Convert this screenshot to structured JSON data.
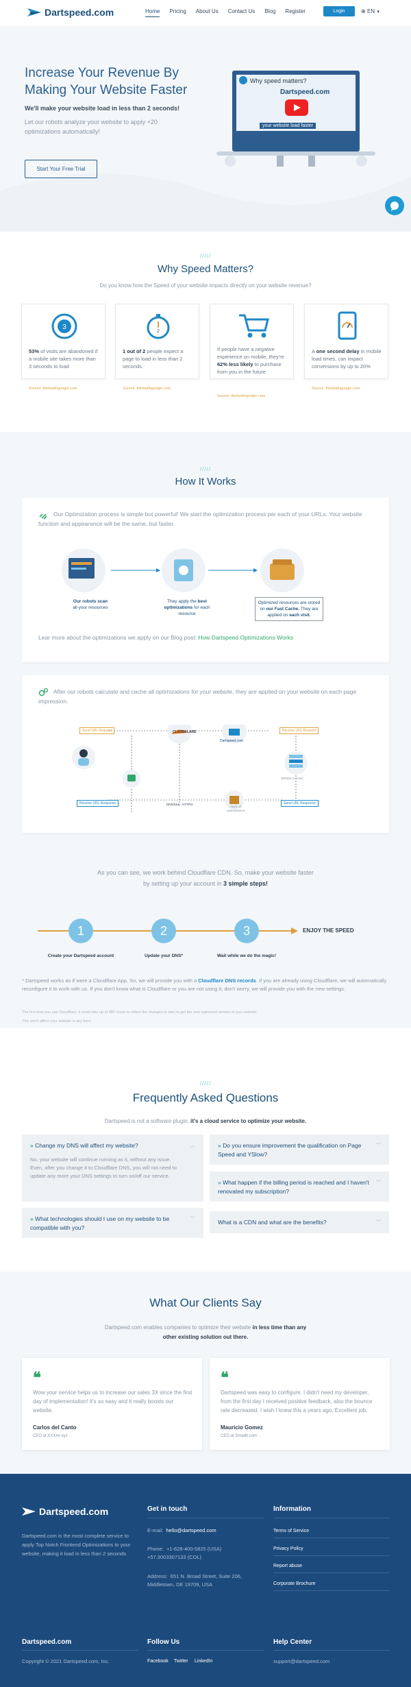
{
  "nav": {
    "logo": "Dartspeed.com",
    "items": [
      "Home",
      "Pricing",
      "About Us",
      "Contact Us",
      "Blog",
      "Register"
    ],
    "login": "Login",
    "lang": "EN"
  },
  "hero": {
    "title": "Increase Your Revenue By Making Your Website Faster",
    "subtitle": "We'll make your website load in less than 2 seconds!",
    "desc": "Let our robots analyze your website to apply +20 optimizations automatically!",
    "cta": "Start Your Free Trial",
    "video_title": "Why speed matters?",
    "video_brand": "Dartspeed.com",
    "video_caption": "your website load faster"
  },
  "why": {
    "dashes": "/////",
    "title": "Why Speed Matters?",
    "subtitle": "Do you know how the Speed of your website impacts directly on your website revenue?",
    "cards": [
      {
        "pre": "",
        "bold": "53%",
        "post": " of visits are abandoned if a mobile site takes more than 3 seconds to load",
        "source": "Source: thinkwithgoogle.com"
      },
      {
        "pre": "",
        "bold": "1 out of 2",
        "post": " people expect a page to load in less than 2 seconds.",
        "source": "Source: thinkwithgoogle.com"
      },
      {
        "pre": "If people have a negative experience on mobile, they're ",
        "bold": "62% less likely",
        "post": " to purchase from you in the future",
        "source": "Source: thinkwithgoogle.com"
      },
      {
        "pre": "A ",
        "bold": "one second delay",
        "post": " in mobile load times, can impact conversions by up to 20%",
        "source": "Source: thinkwithgoogle.com"
      }
    ]
  },
  "how": {
    "dashes": "/////",
    "title": "How It Works",
    "p1": "Our Optimization process is simple but powerful! We start the optimization process per each of your URLs. Your website function and appearance will be the same, but faster.",
    "step_a_bold": "Our robots scan",
    "step_a": "all your resources",
    "step_b": "They apply the",
    "step_b_bold": "best optimizations",
    "step_b2": "for each resource",
    "step_c": "Optimized resources are stored on",
    "step_c_bold": "our Fast Cache.",
    "step_c2": "They are applied on",
    "step_c_bold2": "each visit.",
    "blog_text": "Lear more about the optimizations we apply on our Blog post:",
    "blog_link": "How Dartspeed Optimizations Works",
    "p2": "After our robots calculate and cache all optimizations for your website, they are applied on your website on each page impression.",
    "diagram": {
      "send": "Send URL Request",
      "cloudflare": "CLOUDFLARE",
      "dartspeed": "Dartspeed.com",
      "receive_r": "Receive URL Request",
      "send_resp": "Send URL Response",
      "receive_resp": "Receive URL Response",
      "dns": "DNS/SSL - HTTP/2",
      "apply": "Apply all optimizations",
      "cache": "SPEED CACHE"
    },
    "cf1": "As you can see, we work behind Cloudflare CDN. So, make your website faster",
    "cf2_pre": "by setting up your account in ",
    "cf2_bold": "3 simple steps!",
    "steps": [
      {
        "n": "1",
        "label": "Create your Dartspeed account"
      },
      {
        "n": "2",
        "label": "Update your DNS*"
      },
      {
        "n": "3",
        "label": "Wait while we do the magic!"
      }
    ],
    "enjoy": "ENJOY THE SPEED",
    "note1_pre": "* Dartspeed works as if were a Cloudflare App. So, we will provide you with a ",
    "note1_bold": "Cloudflare DNS records",
    "note1_post": ". If you are already using Cloudflare, we will automatically reconfigure it to work with us. If you don't know what is Cloudflare or you are not using it, don't worry, we will provide you with the new settings.",
    "note2": "The first time you use Cloudflare, it could take up to 48h hours to reflect the changes to start to get the new optimized version of your website.",
    "note3": "This won't affect your website in any form."
  },
  "faq": {
    "dashes": "/////",
    "title": "Frequently Asked Questions",
    "sub_pre": "Dartspeed is not a software plugin, ",
    "sub_bold": "it's a cloud service to optimize your website.",
    "items": [
      {
        "q": "Change my DNS will affect my website?",
        "a": "No, your website will continue running as it, without any issue. Even, after you change it to Cloudflare DNS, you will not need to update any more your DNS settings to turn on/off our service."
      },
      {
        "q": "What technologies should I use on my website to be compatible with you?"
      },
      {
        "q": "Do you ensure improvement the qualification on Page Speed and YSlow?"
      },
      {
        "q": "What happen if the billing period is reached and I haven't renovated my subscription?"
      },
      {
        "q": "What is a CDN and what are the benefits?"
      }
    ]
  },
  "clients": {
    "title": "What Our Clients Say",
    "sub_pre": "Dartspeed.com enables companies to optimize their website ",
    "sub_bold": "in less time than any other existing solution out there.",
    "items": [
      {
        "quote": "Wow your service helps us to increase our sales 3X since the first day of implementation! It's so easy and it really boosts our website.",
        "name": "Carlos del Canto",
        "role": "CEO at XXX##.xyz"
      },
      {
        "quote": "Dartspeed was easy to configure, I didn't need my developer, from the first day I received positive feedback, also the bounce rate decreased. I wish I knew this a years ago. Excellent job.",
        "name": "Mauricio Gomez",
        "role": "CEO at Smadit.com"
      }
    ]
  },
  "footer": {
    "brand": "Dartspeed.com",
    "desc": "Dartspeed.com is the most complete service to apply Top Notch Frontend Optimizations to your website, making it load in less than 2 seconds",
    "touch_title": "Get in touch",
    "email_label": "E-mail:",
    "email": "hello@dartspeed.com",
    "phone_label": "Phone:",
    "phone1": "+1-628-400-5825 (USA)",
    "phone2": "+57.3003307133 (COL)",
    "address_label": "Address:",
    "address1": "651 N. Broad Street, Suite 206,",
    "address2": "Middletown, DE 19709, USA",
    "info_title": "Information",
    "info": [
      "Terms of Service",
      "Privacy Policy",
      "Report abuse",
      "Corporate Brochure"
    ],
    "bottom_brand": "Dartspeed.com",
    "copyright": "Copyright © 2021 Dartspeed.com, Inc.",
    "follow": "Follow Us",
    "social": [
      "Facebook",
      "Twitter",
      "LinkedIn"
    ],
    "help": "Help Center",
    "help_email": "support@dartspeed.com"
  }
}
